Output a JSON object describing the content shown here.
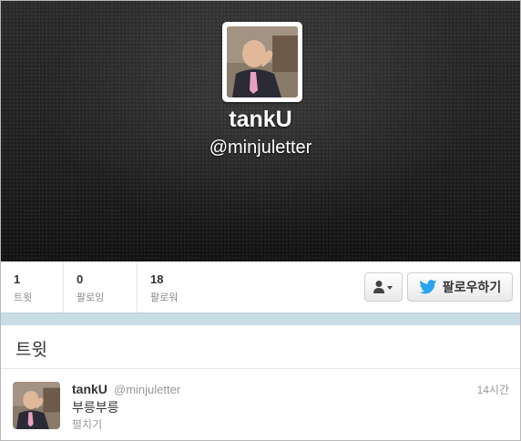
{
  "profile": {
    "name": "tankU",
    "handle": "@minjuletter",
    "avatar_icon": "profile-photo"
  },
  "stats": [
    {
      "count": "1",
      "label": "트윗"
    },
    {
      "count": "0",
      "label": "팔로잉"
    },
    {
      "count": "18",
      "label": "팔로워"
    }
  ],
  "actions": {
    "user_menu_icon": "user-dropdown-icon",
    "follow_label": "팔로우하기"
  },
  "tweets_section": {
    "heading": "트윗"
  },
  "tweet": {
    "name": "tankU",
    "handle": "@minjuletter",
    "time": "14시간",
    "text": "부릉부릉",
    "expand_label": "펼치기"
  },
  "colors": {
    "header_bg": "#1d1d1d",
    "divider_band": "#c9dde7",
    "twitter_blue": "#2aa3ef"
  }
}
